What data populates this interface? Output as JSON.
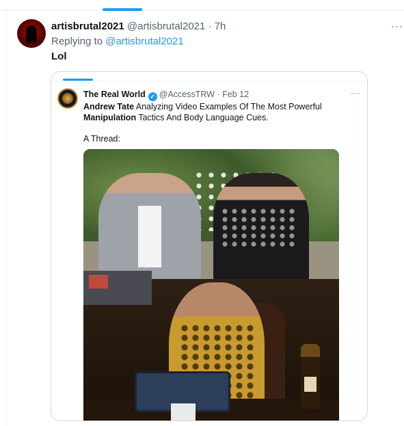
{
  "tweet": {
    "author_name": "artisbrutal2021",
    "author_handle": "@artisbrutal2021",
    "separator": "·",
    "time": "7h",
    "more_icon": "···",
    "replying_to_prefix": "Replying to",
    "replying_to_handle": "@artisbrutal2021",
    "text": "Lol"
  },
  "quoted_tweet": {
    "author_name": "The Real World",
    "verified_icon": "✓",
    "author_handle": "@AccessTRW",
    "separator": "·",
    "date": "Feb 12",
    "more_icon": "···",
    "text_bold_1": "Andrew Tate",
    "text_1": " Analyzing Video Examples Of The Most Powerful ",
    "text_bold_2": "Manipulation",
    "text_2": " Tactics And Body Language Cues.",
    "thread_label": "A Thread:"
  },
  "colors": {
    "accent": "#1d9bf0",
    "text_primary": "#0f1419",
    "text_secondary": "#536471",
    "border": "#cfd9de"
  }
}
